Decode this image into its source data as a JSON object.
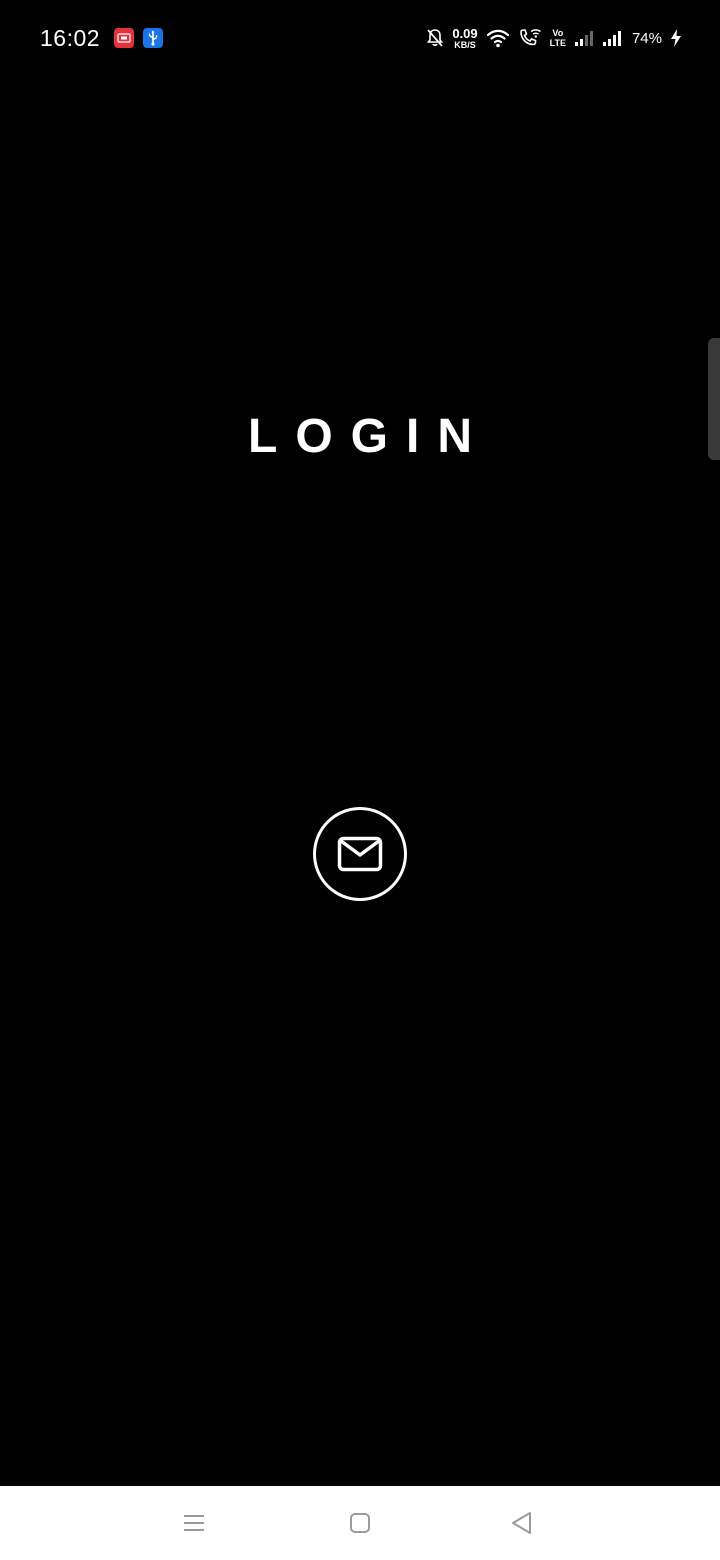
{
  "status_bar": {
    "time": "16:02",
    "net_speed_value": "0.09",
    "net_speed_unit": "KB/S",
    "volte_top": "Vo",
    "volte_bottom": "LTE",
    "battery": "74%",
    "icons": [
      "app-badge-red",
      "usb-icon",
      "mute-icon",
      "wifi-icon",
      "wifi-call-icon",
      "volte-icon",
      "signal-icon",
      "signal-icon",
      "charging-icon"
    ]
  },
  "main": {
    "title": "LOGIN",
    "email_button_icon": "mail-icon"
  },
  "nav_bar": {
    "icons": [
      "menu-icon",
      "home-icon",
      "back-icon"
    ]
  },
  "colors": {
    "background": "#000000",
    "foreground": "#ffffff",
    "badge_red": "#e5313d",
    "badge_blue": "#1a73e8",
    "nav_background": "#ffffff",
    "nav_icon": "#9a9a9a"
  }
}
